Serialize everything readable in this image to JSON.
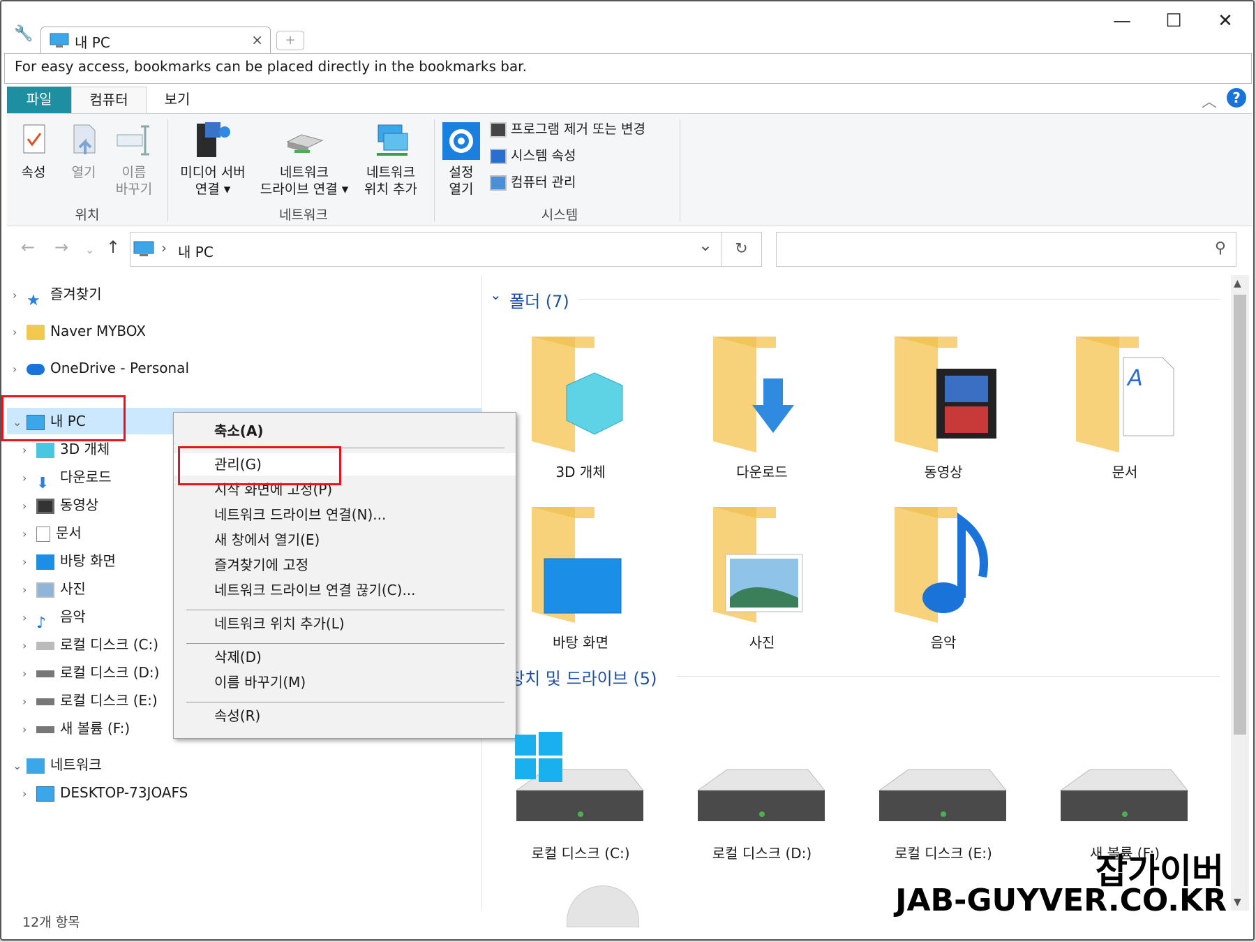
{
  "window": {
    "tab_title": "내 PC",
    "tab_close": "×",
    "new_tab": "+",
    "minimize": "—",
    "maximize": "☐",
    "close": "✕"
  },
  "bookmark_bar": {
    "text": "For easy access, bookmarks can be placed directly in the bookmarks bar."
  },
  "ribbon_tabs": {
    "file": "파일",
    "computer": "컴퓨터",
    "view": "보기"
  },
  "ribbon": {
    "location": {
      "group": "위치",
      "properties": "속성",
      "open": "열기",
      "rename_l1": "이름",
      "rename_l2": "바꾸기"
    },
    "network": {
      "group": "네트워크",
      "media_l1": "미디어 서버",
      "media_l2": "연결 ▾",
      "mapdrive_l1": "네트워크",
      "mapdrive_l2": "드라이브 연결 ▾",
      "addloc_l1": "네트워크",
      "addloc_l2": "위치 추가"
    },
    "system": {
      "group": "시스템",
      "settings_l1": "설정",
      "settings_l2": "열기",
      "uninstall": "프로그램 제거 또는 변경",
      "sysprops": "시스템 속성",
      "manage": "컴퓨터 관리"
    }
  },
  "address": {
    "path_sep": "›",
    "path": "내 PC",
    "refresh": "↻",
    "dropdown": "⌄"
  },
  "nav_tree": {
    "favorites": "즐겨찾기",
    "mybox": "Naver MYBOX",
    "onedrive": "OneDrive - Personal",
    "thispc": "내 PC",
    "objects3d": "3D 개체",
    "downloads": "다운로드",
    "videos": "동영상",
    "documents": "문서",
    "desktop": "바탕 화면",
    "pictures": "사진",
    "music": "음악",
    "drive_c": "로컬 디스크 (C:)",
    "drive_d": "로컬 디스크 (D:)",
    "drive_e": "로컬 디스크 (E:)",
    "drive_f": "새 볼륨 (F:)",
    "network": "네트워크",
    "desktop_host": "DESKTOP-73JOAFS"
  },
  "content": {
    "folders_header": "폴더 (7)",
    "drives_header": "장치 및 드라이브 (5)",
    "folders": [
      "3D 개체",
      "다운로드",
      "동영상",
      "문서",
      "바탕 화면",
      "사진",
      "음악"
    ],
    "drives": [
      "로컬 디스크 (C:)",
      "로컬 디스크 (D:)",
      "로컬 디스크 (E:)",
      "새 볼륨 (F:)"
    ]
  },
  "context_menu": {
    "collapse": "축소(A)",
    "manage": "관리(G)",
    "pin_start": "시작 화면에 고정(P)",
    "map_drive": "네트워크 드라이브 연결(N)...",
    "open_new": "새 창에서 열기(E)",
    "pin_quick": "즐겨찾기에 고정",
    "disconnect": "네트워크 드라이브 연결 끊기(C)...",
    "add_netloc": "네트워크 위치 추가(L)",
    "delete": "삭제(D)",
    "rename": "이름 바꾸기(M)",
    "properties": "속성(R)"
  },
  "status": {
    "count": "12개 항목"
  },
  "watermark": {
    "line1": "잡가이버",
    "line2": "JAB-GUYVER.CO.KR"
  },
  "colors": {
    "accent": "#1d8fa0",
    "folder": "#f7d27a",
    "highlight_red": "#e8141d",
    "selection": "#cce8ff",
    "header_blue": "#1e4fa8"
  }
}
